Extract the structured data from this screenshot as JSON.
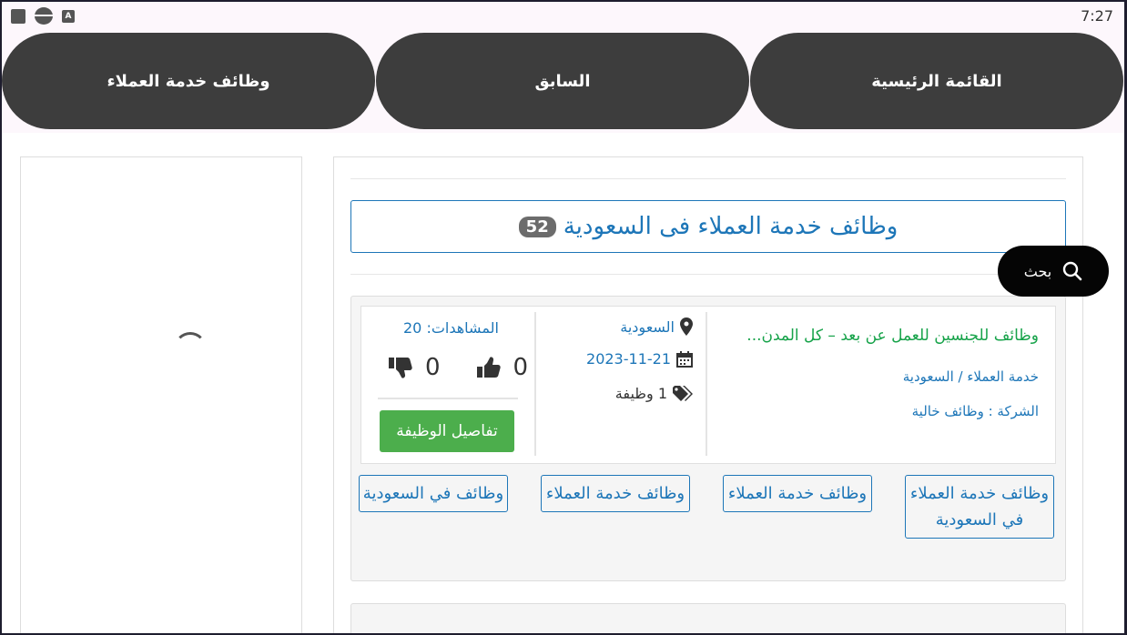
{
  "status_bar": {
    "time": "7:27"
  },
  "nav": {
    "home": "القائمة الرئيسية",
    "back": "السابق",
    "category": "وظائف خدمة العملاء"
  },
  "header": {
    "title": "وظائف خدمة العملاء فى السعودية",
    "count": "52"
  },
  "search": {
    "label": "بحث"
  },
  "job": {
    "title": "وظائف للجنسين للعمل عن بعد – كل المدن...",
    "category": "خدمة العملاء / السعودية",
    "company": "الشركة : وظائف خالية",
    "location": "السعودية",
    "date": "2023-11-21",
    "positions": "1 وظيفة",
    "views": "المشاهدات: 20",
    "likes": "0",
    "dislikes": "0",
    "details_button": "تفاصيل الوظيفة"
  },
  "tags": [
    "وظائف خدمة العملاء في السعودية",
    "وظائف خدمة العملاء",
    "وظائف خدمة العملاء",
    "وظائف في السعودية"
  ],
  "colors": {
    "nav_pill": "#3d3d3d",
    "link_blue": "#1d76b8",
    "job_green": "#17a34a",
    "button_green": "#4cae4c",
    "badge_gray": "#6c6c6c"
  }
}
